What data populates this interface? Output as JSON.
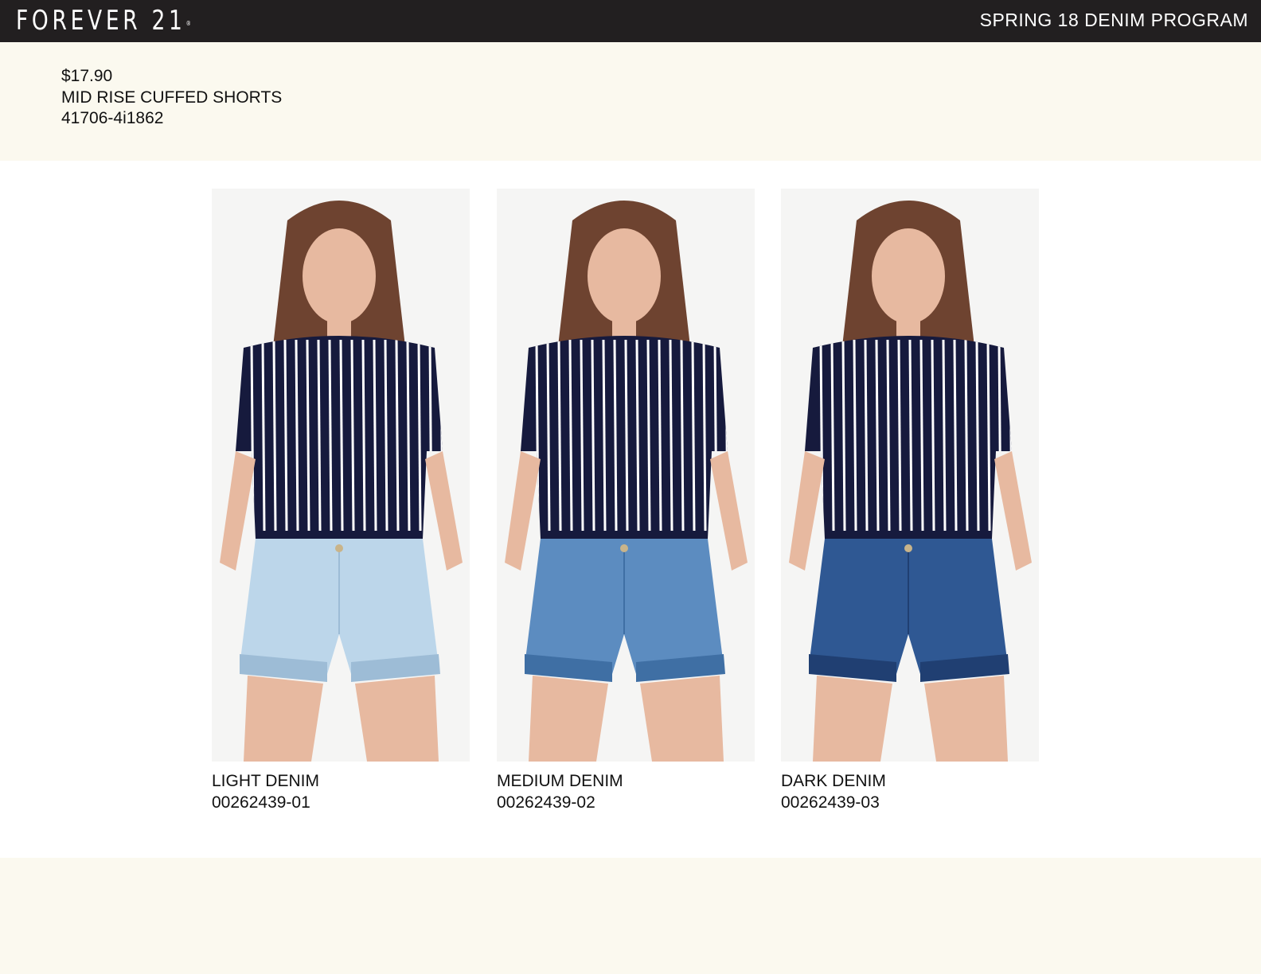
{
  "header": {
    "brand": "FOREVER 21",
    "brand_mark": "®",
    "program": "SPRING 18 DENIM PROGRAM"
  },
  "product": {
    "price": "$17.90",
    "name": "MID RISE CUFFED SHORTS",
    "style_number": "41706-4i1862"
  },
  "colorways": [
    {
      "label": "LIGHT DENIM",
      "code": "00262439-01",
      "denim_color": "#bcd6ea",
      "denim_shadow": "#9dbcd6",
      "pose": "hand-on-hip"
    },
    {
      "label": "MEDIUM DENIM",
      "code": "00262439-02",
      "denim_color": "#5c8cc0",
      "denim_shadow": "#3f6fa4",
      "pose": "hand-to-face"
    },
    {
      "label": "DARK DENIM",
      "code": "00262439-03",
      "denim_color": "#2f5893",
      "denim_shadow": "#203f72",
      "pose": "hands-in-pockets"
    }
  ],
  "colors": {
    "header_bg": "#221f20",
    "band_bg": "#fbf9ef",
    "top_navy": "#161a3d",
    "stripe": "#ffffff",
    "skin": "#e7b9a0",
    "hair": "#6e4330"
  }
}
